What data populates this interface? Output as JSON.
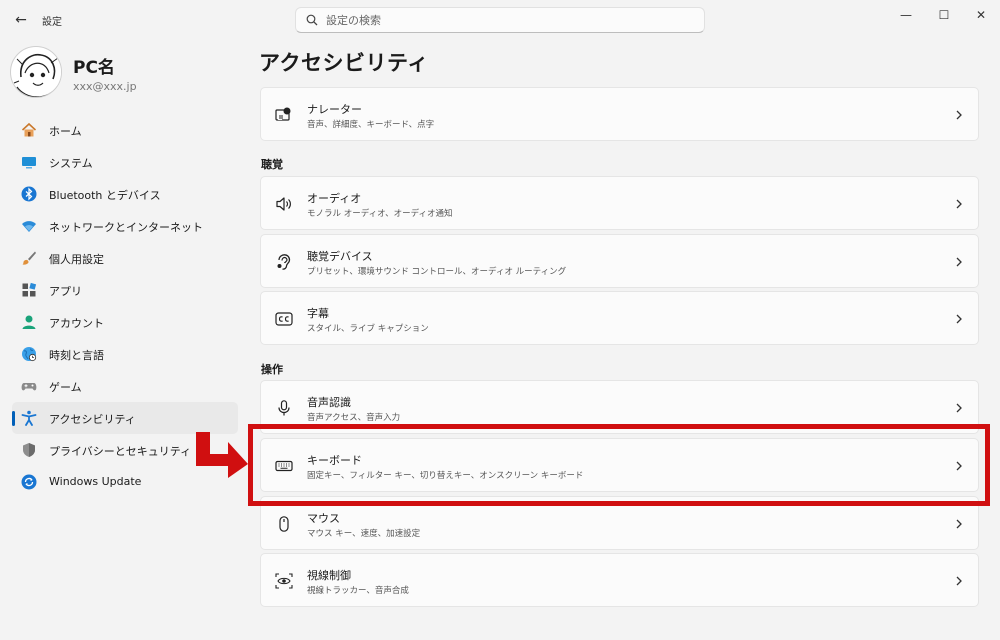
{
  "window": {
    "back_glyph": "←",
    "title": "設定",
    "minimize_glyph": "—",
    "maximize_glyph": "☐",
    "close_glyph": "✕"
  },
  "search": {
    "placeholder": "設定の検索",
    "value": "",
    "icon": "search-icon"
  },
  "profile": {
    "name": "PC名",
    "email": "xxx@xxx.jp"
  },
  "sidebar": {
    "items": [
      {
        "label": "ホーム",
        "icon": "home-icon",
        "active": false
      },
      {
        "label": "システム",
        "icon": "system-icon",
        "active": false
      },
      {
        "label": "Bluetooth とデバイス",
        "icon": "bluetooth-icon",
        "active": false
      },
      {
        "label": "ネットワークとインターネット",
        "icon": "wifi-icon",
        "active": false
      },
      {
        "label": "個人用設定",
        "icon": "brush-icon",
        "active": false
      },
      {
        "label": "アプリ",
        "icon": "apps-icon",
        "active": false
      },
      {
        "label": "アカウント",
        "icon": "account-icon",
        "active": false
      },
      {
        "label": "時刻と言語",
        "icon": "globe-icon",
        "active": false
      },
      {
        "label": "ゲーム",
        "icon": "gamepad-icon",
        "active": false
      },
      {
        "label": "アクセシビリティ",
        "icon": "accessibility-icon",
        "active": true
      },
      {
        "label": "プライバシーとセキュリティ",
        "icon": "shield-icon",
        "active": false
      },
      {
        "label": "Windows Update",
        "icon": "update-icon",
        "active": false
      }
    ]
  },
  "main": {
    "title": "アクセシビリティ",
    "vision_cards": [
      {
        "title": "ナレーター",
        "subtitle": "音声、詳細度、キーボード、点字",
        "icon": "narrator-icon"
      }
    ],
    "hearing": {
      "header": "聴覚",
      "cards": [
        {
          "title": "オーディオ",
          "subtitle": "モノラル オーディオ、オーディオ通知",
          "icon": "speaker-icon"
        },
        {
          "title": "聴覚デバイス",
          "subtitle": "プリセット、環境サウンド コントロール、オーディオ ルーティング",
          "icon": "ear-icon"
        },
        {
          "title": "字幕",
          "subtitle": "スタイル、ライブ キャプション",
          "icon": "cc-icon"
        }
      ]
    },
    "interaction": {
      "header": "操作",
      "cards": [
        {
          "title": "音声認識",
          "subtitle": "音声アクセス、音声入力",
          "icon": "microphone-icon"
        },
        {
          "title": "キーボード",
          "subtitle": "固定キー、フィルター キー、切り替えキー、オンスクリーン キーボード",
          "icon": "keyboard-icon"
        },
        {
          "title": "マウス",
          "subtitle": "マウス キー、速度、加速設定",
          "icon": "mouse-icon"
        },
        {
          "title": "視線制御",
          "subtitle": "視線トラッカー、音声合成",
          "icon": "eye-control-icon"
        }
      ]
    }
  },
  "annotation": {
    "highlight_color": "#d00f10",
    "accent": "#005fb8"
  }
}
